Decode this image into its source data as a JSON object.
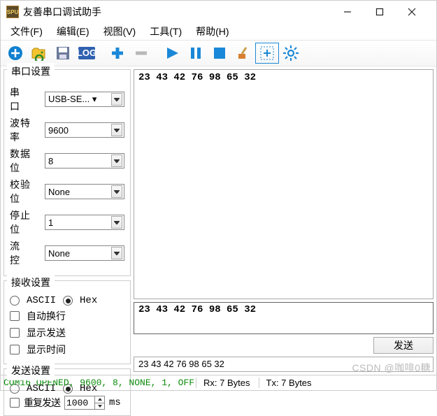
{
  "title": "友善串口调试助手",
  "menu": {
    "file": "文件(F)",
    "edit": "编辑(E)",
    "view": "视图(V)",
    "tools": "工具(T)",
    "help": "帮助(H)"
  },
  "toolbar_icons": [
    "add",
    "open-folder",
    "save",
    "log",
    "plus",
    "minus",
    "play",
    "pause",
    "stop",
    "brush",
    "select-add",
    "settings"
  ],
  "serial": {
    "title": "串口设置",
    "port_label": "串  口",
    "port_value": "USB-SE... ▾",
    "baud_label": "波特率",
    "baud_value": "9600",
    "data_label": "数据位",
    "data_value": "8",
    "parity_label": "校验位",
    "parity_value": "None",
    "stop_label": "停止位",
    "stop_value": "1",
    "flow_label": "流  控",
    "flow_value": "None"
  },
  "recv": {
    "title": "接收设置",
    "ascii": "ASCII",
    "hex": "Hex",
    "hex_selected": true,
    "wrap": "自动换行",
    "show_send": "显示发送",
    "show_time": "显示时间"
  },
  "send": {
    "title": "发送设置",
    "ascii": "ASCII",
    "hex": "Hex",
    "hex_selected": true,
    "repeat": "重复发送",
    "interval": "1000",
    "unit": "ms",
    "button": "发送"
  },
  "rx_text": "23 43 42 76 98 65 32",
  "tx_text": "23 43 42 76 98 65 32",
  "history_value": "23 43 42 76 98 65 32",
  "status": {
    "conn": "COM16 OPENED, 9600, 8, NONE, 1, OFF",
    "rx": "Rx: 7 Bytes",
    "tx": "Tx: 7 Bytes"
  },
  "watermark": "CSDN @咖啡0糖"
}
